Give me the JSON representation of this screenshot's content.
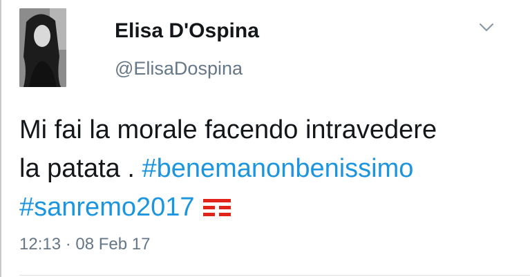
{
  "author": {
    "name": "Elisa D'Ospina",
    "handle": "@ElisaDospina"
  },
  "tweet": {
    "text_line1": "Mi fai la morale facendo intravedere",
    "text_line2_plain": "la patata . ",
    "hashtags": [
      "#benemanonbenissimo",
      "#sanremo2017"
    ],
    "emoji_icon": "tim-logo-icon"
  },
  "meta": {
    "timestamp": "12:13 · 08 Feb 17"
  },
  "icons": {
    "menu": "chevron-down-icon"
  },
  "colors": {
    "hashtag": "#1b95e0",
    "secondary": "#657786",
    "text": "#14171a",
    "logo": "#e2231a"
  }
}
